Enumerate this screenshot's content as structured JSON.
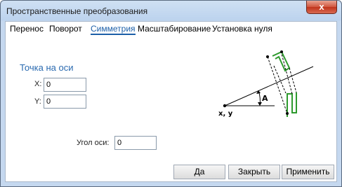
{
  "window": {
    "title": "Пространственные преобразования",
    "close_glyph": "x"
  },
  "tabs": [
    {
      "label": "Перенос"
    },
    {
      "label": "Поворот"
    },
    {
      "label": "Симметрия",
      "active": true
    },
    {
      "label": "Масштабирование"
    },
    {
      "label": "Установка нуля"
    }
  ],
  "axis_point": {
    "heading": "Точка на оси",
    "x_label": "X:",
    "x_value": "0",
    "y_label": "Y:",
    "y_value": "0"
  },
  "angle": {
    "label": "Угол оси:",
    "value": "0"
  },
  "diagram": {
    "origin_label": "x, y",
    "angle_label": "A",
    "shape_color": "#2e9a2e"
  },
  "buttons": {
    "ok": "Да",
    "close": "Закрыть",
    "apply": "Применить"
  }
}
